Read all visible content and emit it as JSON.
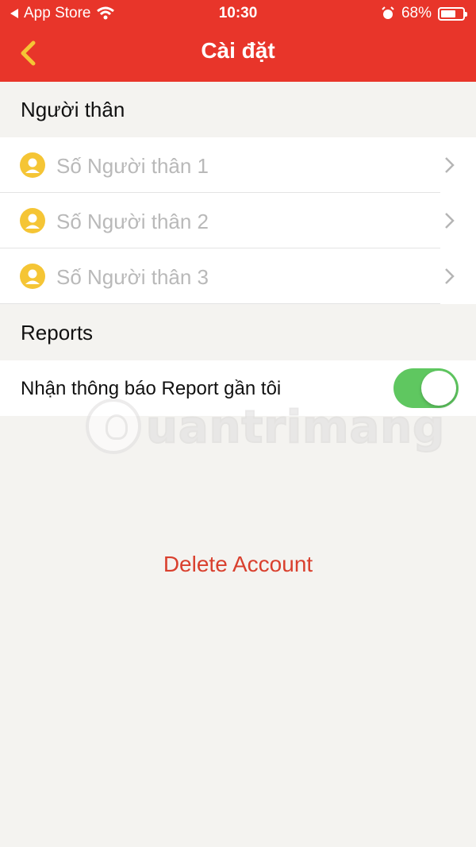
{
  "status_bar": {
    "back_app": "App Store",
    "time": "10:30",
    "battery_percent": "68%",
    "battery_level": 0.68
  },
  "nav": {
    "title": "Cài đặt"
  },
  "sections": {
    "relatives_header": "Người thân",
    "relatives": [
      {
        "label": "Số Người thân 1"
      },
      {
        "label": "Số Người thân 2"
      },
      {
        "label": "Số Người thân 3"
      }
    ],
    "reports_header": "Reports",
    "report_toggle": {
      "label": "Nhận thông báo Report gần tôi",
      "enabled": true
    }
  },
  "watermark": "uantrimang",
  "delete_account": "Delete Account",
  "colors": {
    "header_red": "#e8352a",
    "back_arrow": "#f5c535",
    "toggle_green": "#5fc760",
    "delete_red": "#d9402e"
  }
}
